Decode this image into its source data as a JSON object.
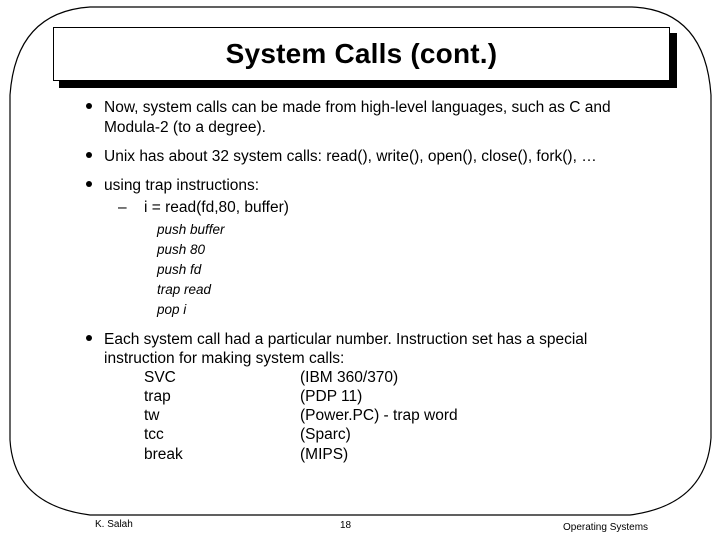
{
  "slide": {
    "title": "System Calls (cont.)",
    "bullets": [
      {
        "lines": [
          "Now, system calls can be made from high-level languages, such as C and",
          "Modula-2 (to a degree)."
        ]
      },
      {
        "lines": [
          "Unix has about 32 system calls: read(), write(), open(), close(), fork(), …"
        ]
      },
      {
        "lines": [
          "using trap instructions:"
        ],
        "sub": {
          "dash": "–",
          "text": "i = read(fd,80, buffer)",
          "code": [
            "push buffer",
            "push 80",
            "push fd",
            "trap read",
            "pop i"
          ]
        }
      },
      {
        "lines": [
          "Each system call had a particular number. Instruction set has a special",
          "instruction for making system calls:"
        ],
        "table": [
          {
            "instruction": "SVC",
            "architecture": "(IBM 360/370)"
          },
          {
            "instruction": "trap",
            "architecture": "(PDP 11)"
          },
          {
            "instruction": "tw",
            "architecture": "(Power.PC) - trap word"
          },
          {
            "instruction": "tcc",
            "architecture": "(Sparc)"
          },
          {
            "instruction": "break",
            "architecture": "(MIPS)"
          }
        ]
      }
    ]
  },
  "footer": {
    "author": "K. Salah",
    "page_number": "18",
    "course": "Operating Systems"
  }
}
